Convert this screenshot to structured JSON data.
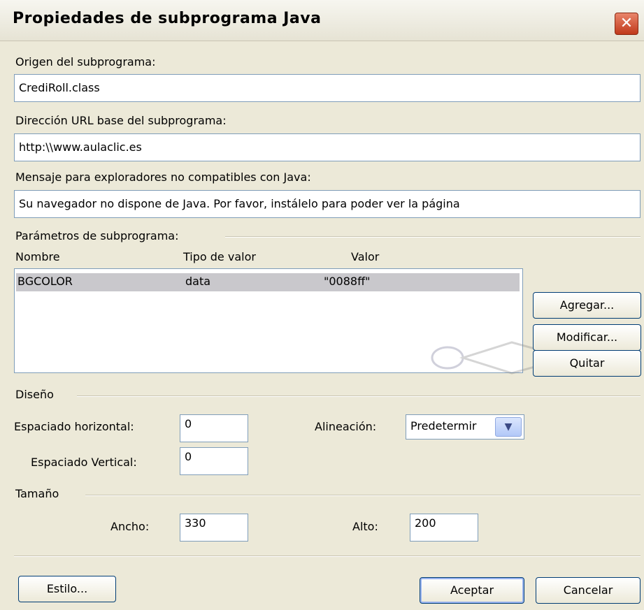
{
  "window": {
    "title": "Propiedades de subprograma Java",
    "close_glyph": "✕"
  },
  "origin": {
    "label": "Origen del subprograma:",
    "value": "CrediRoll.class"
  },
  "base_url": {
    "label": "Dirección URL base del subprograma:",
    "value": "http:\\\\www.aulaclic.es"
  },
  "message": {
    "label": "Mensaje para exploradores no compatibles con Java:",
    "value": "Su navegador no dispone de Java. Por favor, instálelo para poder ver la página"
  },
  "params": {
    "group_label": "Parámetros de subprograma:",
    "columns": [
      "Nombre",
      "Tipo de valor",
      "Valor"
    ],
    "rows": [
      {
        "name": "BGCOLOR",
        "type": "data",
        "value": "\"0088ff\""
      }
    ],
    "buttons": {
      "add": "Agregar...",
      "modify": "Modificar...",
      "remove": "Quitar"
    }
  },
  "design": {
    "group_label": "Diseño",
    "h_spacing_label": "Espaciado horizontal:",
    "h_spacing_value": "0",
    "v_spacing_label": "Espaciado Vertical:",
    "v_spacing_value": "0",
    "align_label": "Alineación:",
    "align_value": "Predetermir",
    "dropdown_glyph": "▼"
  },
  "size": {
    "group_label": "Tamaño",
    "width_label": "Ancho:",
    "width_value": "330",
    "height_label": "Alto:",
    "height_value": "200"
  },
  "footer": {
    "style": "Estilo...",
    "ok": "Aceptar",
    "cancel": "Cancelar"
  },
  "colors": {
    "background": "#ECE9D8",
    "selection": "#C9C8CC",
    "close_button": "#C0391B",
    "border": "#003C74"
  }
}
